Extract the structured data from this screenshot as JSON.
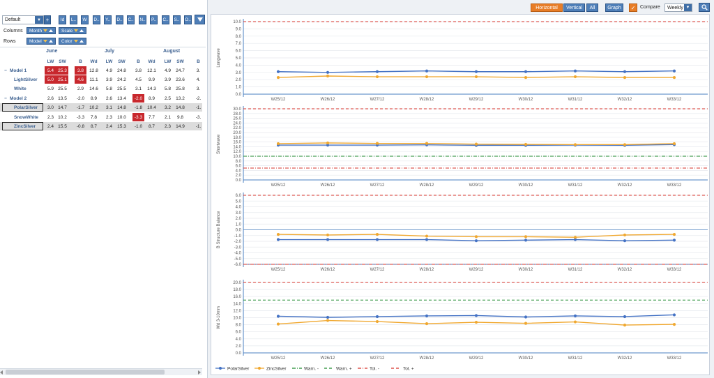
{
  "toolbar": {
    "preset": "Default",
    "plus": "+",
    "column_buttons": [
      "Id",
      "L..",
      "W",
      "D..",
      "Y..",
      "D..",
      "C..",
      "N..",
      "P..",
      "C..",
      "S..",
      "O.."
    ]
  },
  "pivot_config": {
    "columns_label": "Columns",
    "rows_label": "Rows",
    "column_fields": [
      "Month",
      "Scale"
    ],
    "row_fields": [
      "Model",
      "Color"
    ]
  },
  "pivot": {
    "months": [
      "June",
      "July",
      "August"
    ],
    "measures": [
      "LW",
      "SW",
      "B",
      "Wd"
    ],
    "rows": [
      {
        "label": "Model 1",
        "level": 0,
        "values": [
          "5.4",
          "25.3",
          "3.8",
          "12.8",
          "4.9",
          "24.8",
          "3.8",
          "12.1",
          "4.9",
          "24.7",
          "3."
        ],
        "red": [
          0,
          1,
          2
        ]
      },
      {
        "label": "LightSilver",
        "level": 1,
        "values": [
          "5.0",
          "25.1",
          "4.6",
          "11.1",
          "3.9",
          "24.2",
          "4.5",
          "9.9",
          "3.9",
          "23.6",
          "4."
        ],
        "red": [
          0,
          1,
          2
        ]
      },
      {
        "label": "White",
        "level": 1,
        "values": [
          "5.9",
          "25.5",
          "2.9",
          "14.6",
          "5.8",
          "25.5",
          "3.1",
          "14.3",
          "5.8",
          "25.8",
          "3."
        ],
        "red": []
      },
      {
        "label": "Model 2",
        "level": 0,
        "values": [
          "2.6",
          "13.5",
          "-2.0",
          "8.9",
          "2.6",
          "13.4",
          "-2.0",
          "8.9",
          "2.5",
          "13.2",
          "-2."
        ],
        "red": [
          6
        ]
      },
      {
        "label": "PolarSilver",
        "level": 1,
        "values": [
          "3.0",
          "14.7",
          "-1.7",
          "10.2",
          "3.1",
          "14.8",
          "-1.8",
          "10.4",
          "3.2",
          "14.8",
          "-1."
        ],
        "red": [],
        "boxed": true,
        "shaded": true
      },
      {
        "label": "SnowWhite",
        "level": 1,
        "values": [
          "2.3",
          "10.2",
          "-3.3",
          "7.8",
          "2.3",
          "10.0",
          "-3.3",
          "7.7",
          "2.1",
          "9.8",
          "-3."
        ],
        "red": [
          6
        ]
      },
      {
        "label": "ZincSilver",
        "level": 1,
        "values": [
          "2.4",
          "15.5",
          "-0.8",
          "8.7",
          "2.4",
          "15.3",
          "-1.0",
          "8.7",
          "2.3",
          "14.9",
          "-1."
        ],
        "red": [],
        "boxed": true,
        "shaded": true
      }
    ]
  },
  "topbar": {
    "horizontal": "Horizontal",
    "vertical": "Vertical",
    "all": "All",
    "graph": "Graph",
    "compare_label": "Compare",
    "period": "Weekly"
  },
  "colors": {
    "polar": "#4472c4",
    "zinc": "#f0a830",
    "warn": "#1d8a2e",
    "tol": "#d6332b",
    "accent": "#e87d27",
    "button": "#4f7fb8"
  },
  "chart_data": [
    {
      "type": "line",
      "ylabel": "Longwave",
      "categories": [
        "W25/12",
        "W26/12",
        "W27/12",
        "W28/12",
        "W29/12",
        "W30/12",
        "W31/12",
        "W32/12",
        "W33/12"
      ],
      "ylim": [
        0,
        10
      ],
      "yticks": [
        "0.0",
        "1.0",
        "2.0",
        "3.0",
        "4.0",
        "5.0",
        "6.0",
        "7.0",
        "8.0",
        "9.0",
        "10.0"
      ],
      "series": [
        {
          "name": "PolarSilver",
          "values": [
            3.1,
            3.0,
            3.1,
            3.2,
            3.1,
            3.1,
            3.2,
            3.1,
            3.2
          ]
        },
        {
          "name": "ZincSilver",
          "values": [
            2.3,
            2.5,
            2.4,
            2.4,
            2.4,
            2.3,
            2.4,
            2.3,
            2.3
          ]
        }
      ],
      "limits": {
        "tol_plus": 10.0
      }
    },
    {
      "type": "line",
      "ylabel": "Shortwave",
      "categories": [
        "W25/12",
        "W26/12",
        "W27/12",
        "W28/12",
        "W29/12",
        "W30/12",
        "W31/12",
        "W32/12",
        "W33/12"
      ],
      "ylim": [
        0,
        30
      ],
      "yticks": [
        "0.0",
        "2.0",
        "4.0",
        "6.0",
        "8.0",
        "10.0",
        "12.0",
        "14.0",
        "16.0",
        "18.0",
        "20.0",
        "22.0",
        "24.0",
        "26.0",
        "28.0",
        "30.0"
      ],
      "series": [
        {
          "name": "PolarSilver",
          "values": [
            14.7,
            14.7,
            14.7,
            14.8,
            14.6,
            14.6,
            14.7,
            14.6,
            14.9
          ]
        },
        {
          "name": "ZincSilver",
          "values": [
            15.3,
            15.6,
            15.4,
            15.4,
            15.1,
            15.0,
            14.9,
            14.9,
            15.3
          ]
        }
      ],
      "limits": {
        "warn_minus": 10.0,
        "tol_minus": 5.0,
        "tol_plus": 30.0
      }
    },
    {
      "type": "line",
      "ylabel": "B Structure Balance",
      "categories": [
        "W25/12",
        "W26/12",
        "W27/12",
        "W28/12",
        "W29/12",
        "W30/12",
        "W31/12",
        "W32/12",
        "W33/12"
      ],
      "ylim": [
        -6,
        6
      ],
      "yticks": [
        "-6.0",
        "-5.0",
        "-4.0",
        "-3.0",
        "-2.0",
        "-1.0",
        "0.0",
        "1.0",
        "2.0",
        "3.0",
        "4.0",
        "5.0",
        "6.0"
      ],
      "series": [
        {
          "name": "PolarSilver",
          "values": [
            -1.7,
            -1.7,
            -1.7,
            -1.7,
            -1.9,
            -1.8,
            -1.7,
            -1.9,
            -1.8
          ]
        },
        {
          "name": "ZincSilver",
          "values": [
            -0.8,
            -0.9,
            -0.8,
            -1.1,
            -1.2,
            -1.2,
            -1.3,
            -0.9,
            -0.8
          ]
        }
      ],
      "limits": {
        "tol_minus": -6.0,
        "tol_plus": 6.0
      }
    },
    {
      "type": "line",
      "ylabel": "Wd 3-10mm",
      "categories": [
        "W25/12",
        "W26/12",
        "W27/12",
        "W28/12",
        "W29/12",
        "W30/12",
        "W31/12",
        "W32/12",
        "W33/12"
      ],
      "ylim": [
        0,
        20
      ],
      "yticks": [
        "0.0",
        "2.0",
        "4.0",
        "6.0",
        "8.0",
        "10.0",
        "12.0",
        "14.0",
        "16.0",
        "18.0",
        "20.0"
      ],
      "series": [
        {
          "name": "PolarSilver",
          "values": [
            10.4,
            10.1,
            10.3,
            10.5,
            10.6,
            10.2,
            10.5,
            10.3,
            10.8
          ]
        },
        {
          "name": "ZincSilver",
          "values": [
            8.2,
            9.2,
            8.9,
            8.3,
            8.7,
            8.4,
            8.8,
            7.9,
            8.1
          ]
        }
      ],
      "limits": {
        "warn_plus": 15.0,
        "tol_plus": 20.0
      }
    }
  ],
  "legend": {
    "items": [
      {
        "label": "PolarSilver",
        "kind": "polar"
      },
      {
        "label": "ZincSilver",
        "kind": "zinc"
      },
      {
        "label": "Warn. -",
        "kind": "warn-minus"
      },
      {
        "label": "Warn. +",
        "kind": "warn-plus"
      },
      {
        "label": "Tol. -",
        "kind": "tol-minus"
      },
      {
        "label": "Tol. +",
        "kind": "tol-plus"
      }
    ]
  }
}
